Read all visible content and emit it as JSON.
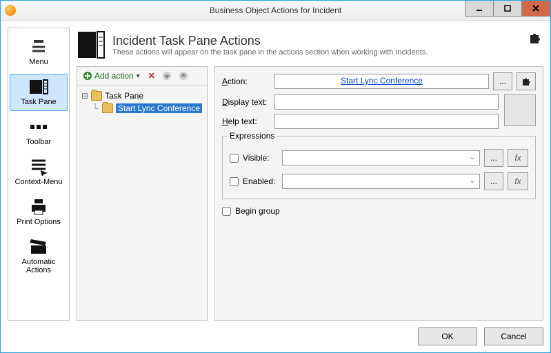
{
  "window": {
    "title": "Business Object Actions for Incident"
  },
  "sidebar": {
    "items": [
      {
        "label": "Menu"
      },
      {
        "label": "Task Pane"
      },
      {
        "label": "Toolbar"
      },
      {
        "label": "Context-Menu"
      },
      {
        "label": "Print Options"
      },
      {
        "label": "Automatic Actions"
      }
    ]
  },
  "header": {
    "title": "Incident Task Pane Actions",
    "subtitle": "These actions will appear on the task pane in the actions section when working with Incidents."
  },
  "tree": {
    "add_action_label": "Add action",
    "root": "Task Pane",
    "selected": "Start Lync Conference"
  },
  "form": {
    "action_label": "Action:",
    "action_value": "Start Lync Conference",
    "display_label": "Display text:",
    "display_value": "",
    "help_label": "Help text:",
    "help_value": "",
    "expressions_label": "Expressions",
    "visible_label": "Visible:",
    "enabled_label": "Enabled:",
    "begin_group_label": "Begin group",
    "ellipsis": "...",
    "fx": "fx"
  },
  "footer": {
    "ok": "OK",
    "cancel": "Cancel"
  }
}
